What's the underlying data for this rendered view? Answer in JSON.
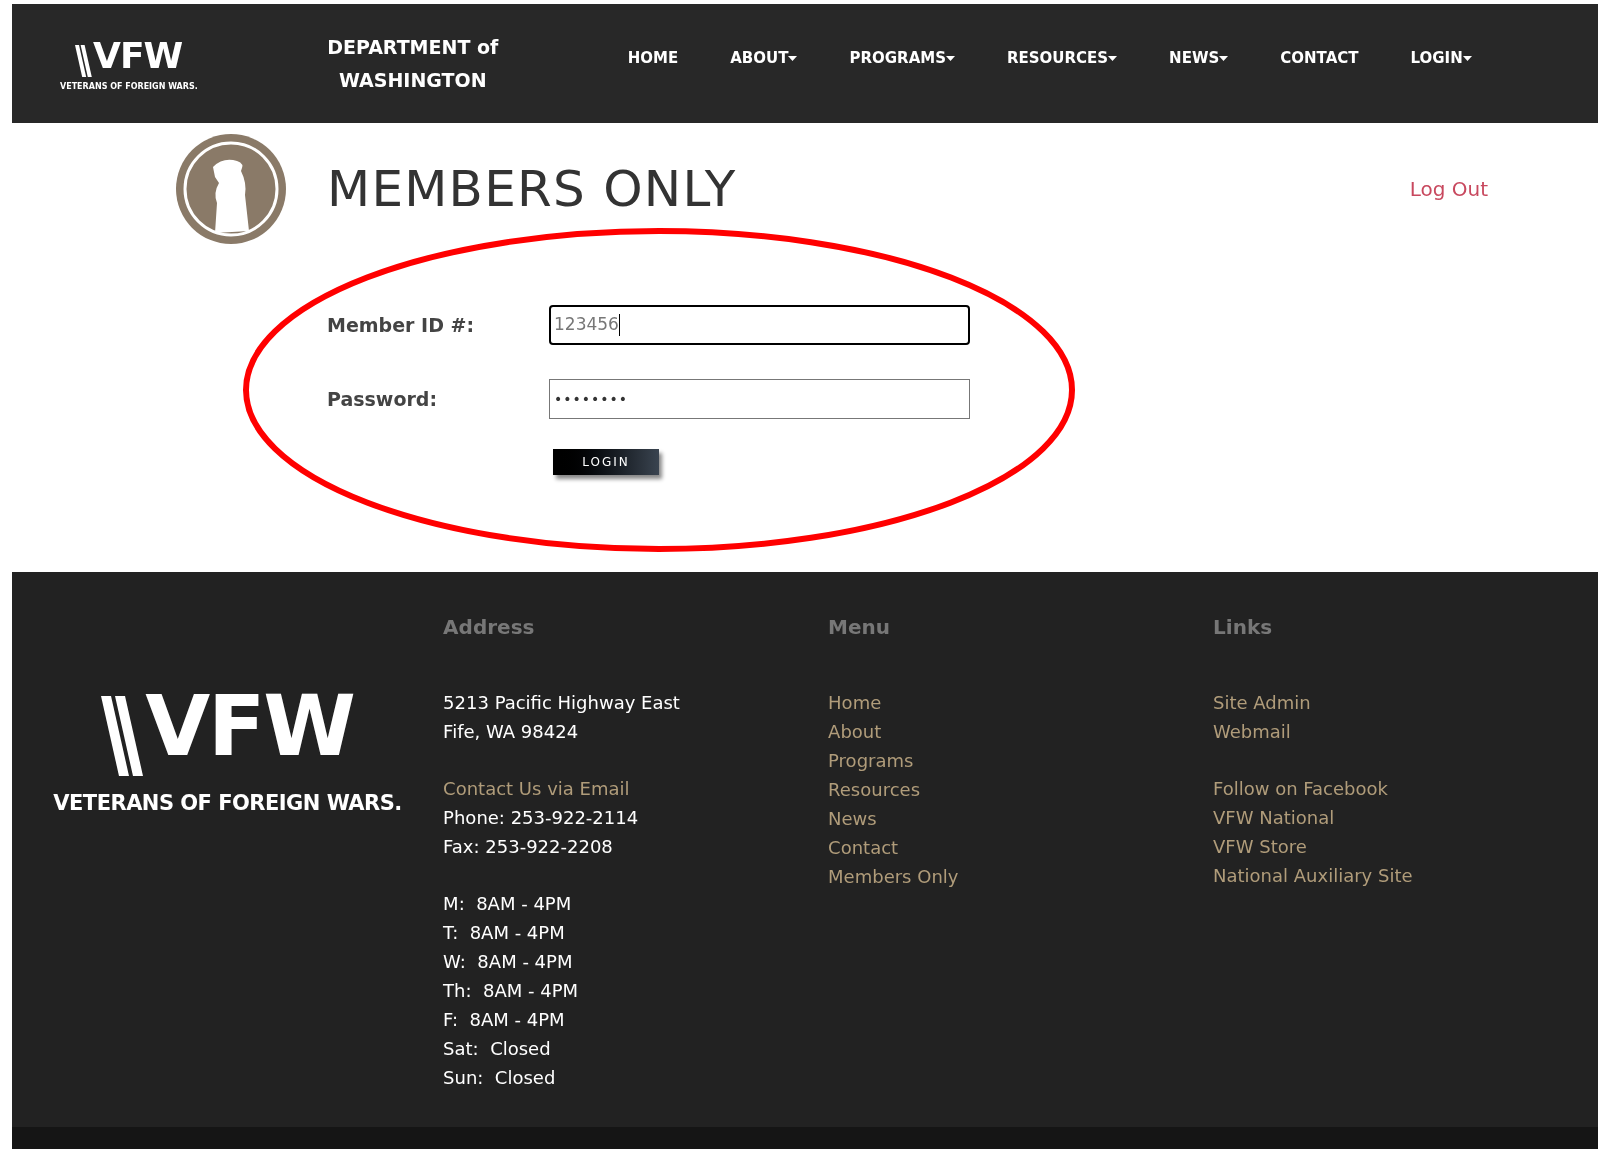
{
  "header": {
    "logo": {
      "wordmark": "VFW",
      "tagline": "VETERANS OF FOREIGN WARS."
    },
    "department": [
      "DEPARTMENT of",
      "WASHINGTON"
    ],
    "nav": [
      {
        "label": "HOME",
        "dropdown": false
      },
      {
        "label": "ABOUT",
        "dropdown": true
      },
      {
        "label": "PROGRAMS",
        "dropdown": true
      },
      {
        "label": "RESOURCES",
        "dropdown": true
      },
      {
        "label": "NEWS",
        "dropdown": true
      },
      {
        "label": "CONTACT",
        "dropdown": false
      },
      {
        "label": "LOGIN",
        "dropdown": true
      }
    ]
  },
  "page": {
    "title": "MEMBERS ONLY",
    "logout": "Log Out"
  },
  "form": {
    "fields": [
      {
        "label": "Member ID #:",
        "value": "123456",
        "kind": "text",
        "focused": true
      },
      {
        "label": "Password:",
        "value": "••••••••",
        "kind": "password",
        "focused": false
      }
    ],
    "button": "LOGIN"
  },
  "footer": {
    "logo": {
      "wordmark": "VFW",
      "tagline": "VETERANS OF FOREIGN WARS."
    },
    "address": {
      "heading": "Address",
      "lines": [
        {
          "text": "5213 Pacific Highway East",
          "kind": "text"
        },
        {
          "text": "Fife, WA 98424",
          "kind": "text"
        },
        {
          "kind": "gap"
        },
        {
          "text": "Contact Us via Email",
          "kind": "link"
        },
        {
          "text": "Phone: 253-922-2114",
          "kind": "text"
        },
        {
          "text": "Fax: 253-922-2208",
          "kind": "text"
        },
        {
          "kind": "gap"
        },
        {
          "text": "M:  8AM - 4PM",
          "kind": "text"
        },
        {
          "text": "T:  8AM - 4PM",
          "kind": "text"
        },
        {
          "text": "W:  8AM - 4PM",
          "kind": "text"
        },
        {
          "text": "Th:  8AM - 4PM",
          "kind": "text"
        },
        {
          "text": "F:  8AM - 4PM",
          "kind": "text"
        },
        {
          "text": "Sat:  Closed",
          "kind": "text"
        },
        {
          "text": "Sun:  Closed",
          "kind": "text"
        }
      ]
    },
    "menu": {
      "heading": "Menu",
      "lines": [
        {
          "text": "Home",
          "kind": "link"
        },
        {
          "text": "About",
          "kind": "link"
        },
        {
          "text": "Programs",
          "kind": "link"
        },
        {
          "text": "Resources",
          "kind": "link"
        },
        {
          "text": "News",
          "kind": "link"
        },
        {
          "text": "Contact",
          "kind": "link"
        },
        {
          "text": "Members Only",
          "kind": "link"
        }
      ]
    },
    "links": {
      "heading": "Links",
      "lines": [
        {
          "text": "Site Admin",
          "kind": "link"
        },
        {
          "text": "Webmail",
          "kind": "link"
        },
        {
          "kind": "gap"
        },
        {
          "text": "Follow on Facebook",
          "kind": "link"
        },
        {
          "text": "VFW National",
          "kind": "link"
        },
        {
          "text": "VFW Store",
          "kind": "link"
        },
        {
          "text": "National Auxiliary Site",
          "kind": "link"
        }
      ]
    }
  }
}
